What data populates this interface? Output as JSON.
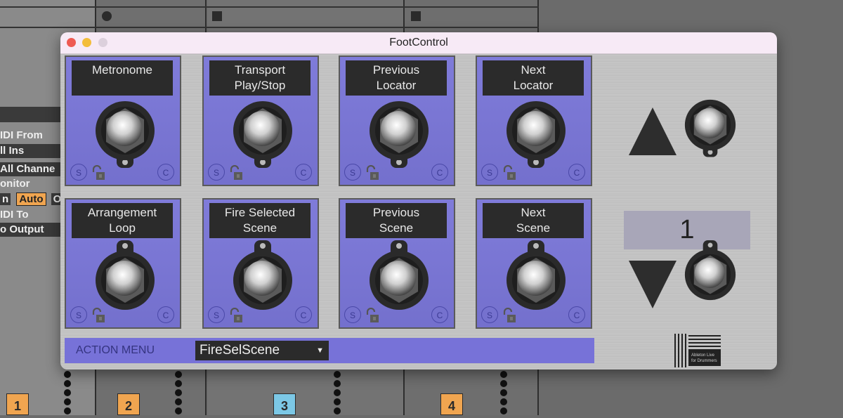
{
  "background": {
    "io_rows": [
      "IDI From",
      "ll Ins",
      "All Channe",
      "onitor",
      "IDI To",
      "o Output"
    ],
    "monitor_options": [
      "n",
      "Auto",
      "O"
    ],
    "monitor_selected": "Auto",
    "track_numbers": [
      {
        "label": "1",
        "color": "#f0a550"
      },
      {
        "label": "2",
        "color": "#f0a550"
      },
      {
        "label": "3",
        "color": "#7cc8e6"
      },
      {
        "label": "4",
        "color": "#f0a550"
      }
    ]
  },
  "window": {
    "title": "FootControl",
    "traffic_lights": {
      "close": "#ee5a52",
      "minimize": "#f3bd3b",
      "zoom": "#dcd0dc"
    }
  },
  "pedals": [
    {
      "label_line1": "Metronome",
      "label_line2": "",
      "s": "S",
      "c": "C"
    },
    {
      "label_line1": "Transport",
      "label_line2": "Play/Stop",
      "s": "S",
      "c": "C"
    },
    {
      "label_line1": "Previous",
      "label_line2": "Locator",
      "s": "S",
      "c": "C"
    },
    {
      "label_line1": "Next",
      "label_line2": "Locator",
      "s": "S",
      "c": "C"
    },
    {
      "label_line1": "Arrangement",
      "label_line2": "Loop",
      "s": "S",
      "c": "C"
    },
    {
      "label_line1": "Fire Selected",
      "label_line2": "Scene",
      "s": "S",
      "c": "C"
    },
    {
      "label_line1": "Previous",
      "label_line2": "Scene",
      "s": "S",
      "c": "C"
    },
    {
      "label_line1": "Next",
      "label_line2": "Scene",
      "s": "S",
      "c": "C"
    }
  ],
  "bank": {
    "value": "1",
    "up_icon": "triangle-up",
    "down_icon": "triangle-down"
  },
  "action_menu": {
    "label": "ACTION MENU",
    "selected": "FireSelScene",
    "arrow": "▼"
  },
  "logo": {
    "text": "Ableton Live for Drummers"
  },
  "colors": {
    "pedal": "#7a76d8",
    "label_bg": "#2b2b2b",
    "panel": "#c4c4c4"
  }
}
